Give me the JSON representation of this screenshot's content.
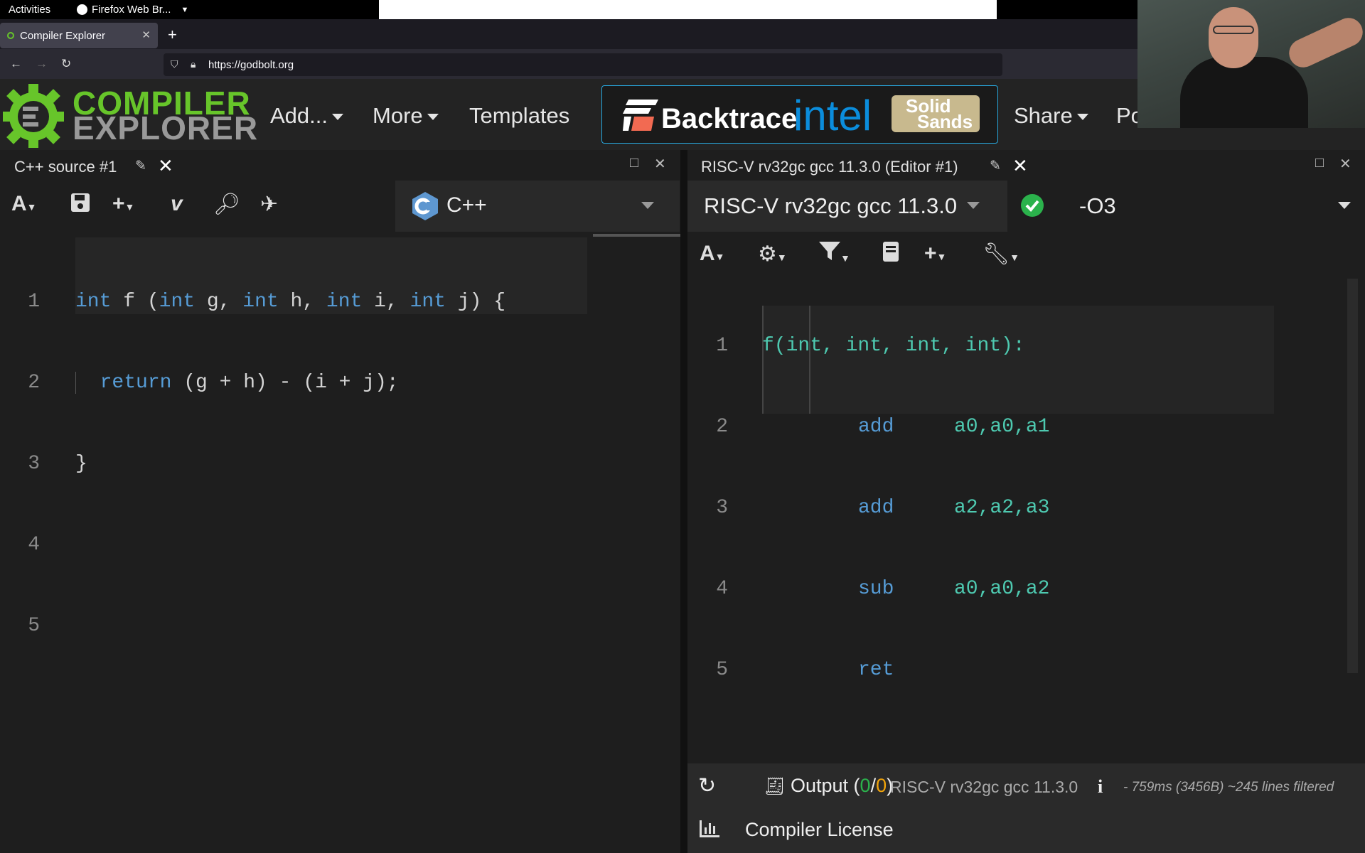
{
  "topbar": {
    "activities": "Activities",
    "app": "Firefox Web Br..."
  },
  "browser": {
    "tab_title": "Compiler Explorer",
    "url": "https://godbolt.org"
  },
  "ce": {
    "logo_line1": "COMPILER",
    "logo_line2": "EXPLORER",
    "menu": {
      "add": "Add...",
      "more": "More",
      "templates": "Templates",
      "share": "Share",
      "policies_partial": "Po"
    },
    "sponsors": {
      "backtrace": "Backtrace",
      "intel": "intel",
      "solid": "Solid",
      "sands": "Sands"
    }
  },
  "left": {
    "title": "C++ source #1",
    "language": "C++",
    "line_numbers": [
      "1",
      "2",
      "3",
      "4",
      "5"
    ],
    "code": {
      "l1_kw1": "int",
      "l1_a": " f (",
      "l1_kw2": "int",
      "l1_b": " g, ",
      "l1_kw3": "int",
      "l1_c": " h, ",
      "l1_kw4": "int",
      "l1_d": " i, ",
      "l1_kw5": "int",
      "l1_e": " j) {",
      "l2_kw": "return",
      "l2_rest": " (g + h) - (i + j);",
      "l3": "}"
    }
  },
  "right": {
    "title": "RISC-V rv32gc gcc 11.3.0 (Editor #1)",
    "compiler": "RISC-V rv32gc gcc 11.3.0",
    "options": "-O3",
    "line_numbers": [
      "1",
      "2",
      "3",
      "4",
      "5"
    ],
    "asm": {
      "label": "f(int, int, int, int):",
      "rows": [
        {
          "op": "add",
          "args": "a0,a0,a1"
        },
        {
          "op": "add",
          "args": "a2,a2,a3"
        },
        {
          "op": "sub",
          "args": "a0,a0,a2"
        },
        {
          "op": "ret",
          "args": ""
        }
      ]
    },
    "status": {
      "output_label": "Output (",
      "output_ok": "0",
      "output_slash": "/",
      "output_err": "0",
      "output_close": ")",
      "compiler": "RISC-V rv32gc gcc 11.3.0",
      "stats": "- 759ms (3456B) ~245 lines filtered",
      "license": "Compiler License"
    }
  },
  "colors": {
    "accent": "#67c52a",
    "sponsor_border": "#28a9e0",
    "ok_green": "#2bb24c",
    "err_orange": "#f0a30a"
  }
}
